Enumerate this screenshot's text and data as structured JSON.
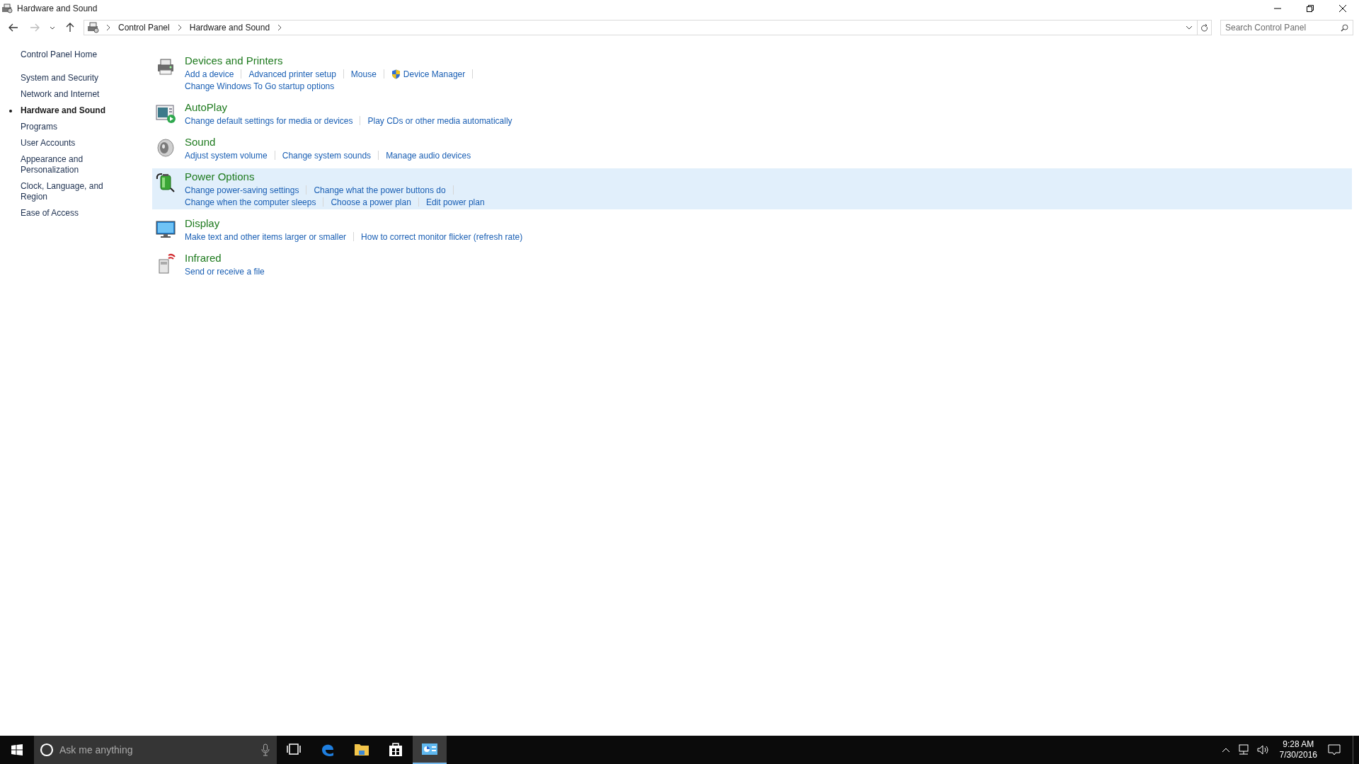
{
  "window": {
    "title": "Hardware and Sound"
  },
  "address_bar": {
    "breadcrumbs": [
      "Control Panel",
      "Hardware and Sound"
    ],
    "search_placeholder": "Search Control Panel"
  },
  "sidebar": {
    "items": [
      {
        "label": "Control Panel Home",
        "selected": false,
        "kind": "home"
      },
      {
        "label": "System and Security",
        "selected": false,
        "kind": "category"
      },
      {
        "label": "Network and Internet",
        "selected": false,
        "kind": "category"
      },
      {
        "label": "Hardware and Sound",
        "selected": true,
        "kind": "category"
      },
      {
        "label": "Programs",
        "selected": false,
        "kind": "category"
      },
      {
        "label": "User Accounts",
        "selected": false,
        "kind": "category"
      },
      {
        "label": "Appearance and Personalization",
        "selected": false,
        "kind": "category"
      },
      {
        "label": "Clock, Language, and Region",
        "selected": false,
        "kind": "category"
      },
      {
        "label": "Ease of Access",
        "selected": false,
        "kind": "category"
      }
    ]
  },
  "categories": [
    {
      "title": "Devices and Printers",
      "kind": "printer",
      "selected": false,
      "link_rows": [
        [
          {
            "label": "Add a device"
          },
          {
            "label": "Advanced printer setup"
          },
          {
            "label": "Mouse"
          },
          {
            "label": "Device Manager",
            "shield": true
          }
        ],
        [
          {
            "label": "Change Windows To Go startup options"
          }
        ]
      ]
    },
    {
      "title": "AutoPlay",
      "kind": "autoplay",
      "selected": false,
      "link_rows": [
        [
          {
            "label": "Change default settings for media or devices"
          },
          {
            "label": "Play CDs or other media automatically"
          }
        ]
      ]
    },
    {
      "title": "Sound",
      "kind": "speaker",
      "selected": false,
      "link_rows": [
        [
          {
            "label": "Adjust system volume"
          },
          {
            "label": "Change system sounds"
          },
          {
            "label": "Manage audio devices"
          }
        ]
      ]
    },
    {
      "title": "Power Options",
      "kind": "battery",
      "selected": true,
      "link_rows": [
        [
          {
            "label": "Change power-saving settings"
          },
          {
            "label": "Change what the power buttons do"
          }
        ],
        [
          {
            "label": "Change when the computer sleeps"
          },
          {
            "label": "Choose a power plan"
          },
          {
            "label": "Edit power plan"
          }
        ]
      ]
    },
    {
      "title": "Display",
      "kind": "monitor",
      "selected": false,
      "link_rows": [
        [
          {
            "label": "Make text and other items larger or smaller"
          },
          {
            "label": "How to correct monitor flicker (refresh rate)"
          }
        ]
      ]
    },
    {
      "title": "Infrared",
      "kind": "infrared",
      "selected": false,
      "link_rows": [
        [
          {
            "label": "Send or receive a file"
          }
        ]
      ]
    }
  ],
  "taskbar": {
    "search_placeholder": "Ask me anything",
    "apps": [
      {
        "kind": "taskview",
        "selected": false
      },
      {
        "kind": "edge",
        "selected": false
      },
      {
        "kind": "explorer",
        "selected": false
      },
      {
        "kind": "store",
        "selected": false
      },
      {
        "kind": "controlpanel",
        "selected": true
      }
    ],
    "time": "9:28 AM",
    "date": "7/30/2016"
  }
}
